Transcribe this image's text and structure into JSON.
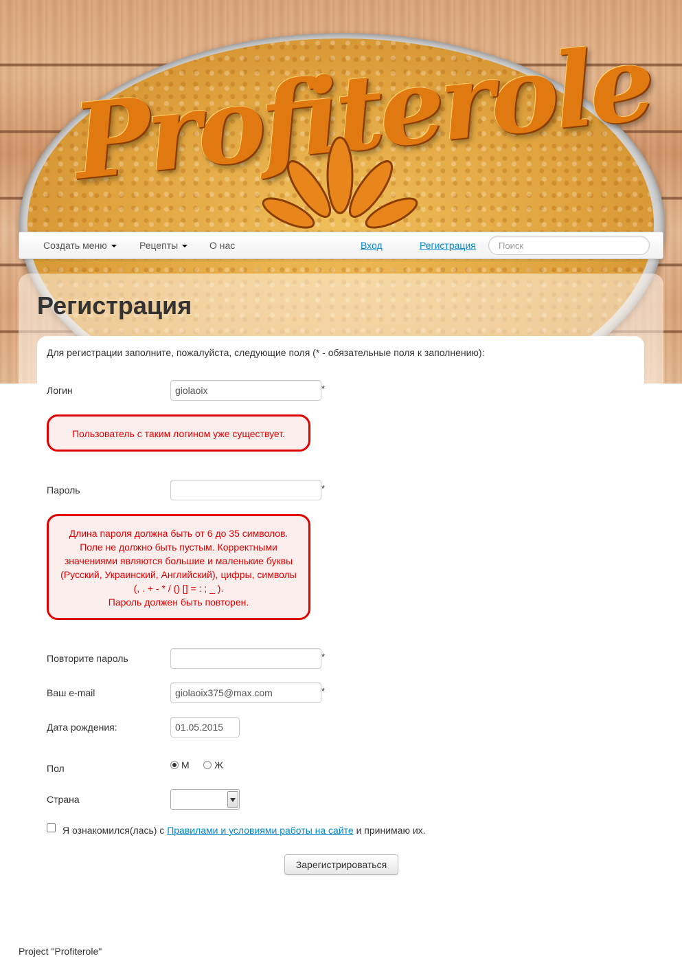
{
  "header": {
    "logo_text": "Profiterole"
  },
  "nav": {
    "menu_items": [
      {
        "label": "Создать меню",
        "has_dropdown": true
      },
      {
        "label": "Рецепты",
        "has_dropdown": true
      },
      {
        "label": "О нас",
        "has_dropdown": false
      }
    ],
    "login_link": "Вход",
    "register_link": "Регистрация",
    "search_placeholder": "Поиск"
  },
  "page": {
    "title": "Регистрация",
    "intro": "Для регистрации заполните, пожалуйста, следующие поля (* - обязательные поля к заполнению):"
  },
  "form": {
    "required_mark": "*",
    "login": {
      "label": "Логин",
      "value": "giolaoix"
    },
    "login_error": "Пользователь с таким логином уже существует.",
    "password": {
      "label": "Пароль",
      "value": ""
    },
    "password_error": [
      "Длина пароля должна быть от 6 до 35 символов.",
      "Поле не должно быть пустым. Корректными",
      "значениями являются большие и маленькие буквы",
      "(Русский, Украинский, Английский), цифры, символы",
      "(, . + - * / () [] = : ; _ ).",
      "Пароль должен быть повторен."
    ],
    "password_repeat": {
      "label": "Повторите пароль",
      "value": ""
    },
    "email": {
      "label": "Ваш e-mail",
      "value": "giolaoix375@max.com"
    },
    "birthdate": {
      "label": "Дата рождения:",
      "value": "01.05.2015"
    },
    "gender": {
      "label": "Пол",
      "options": [
        "М",
        "Ж"
      ],
      "selected": "М"
    },
    "country": {
      "label": "Страна",
      "value": ""
    },
    "agree": {
      "prefix": "Я ознакомился(лась) с ",
      "link": "Правилами и условиями работы на сайте",
      "suffix": " и принимаю их.",
      "checked": false
    },
    "submit_label": "Зарегистрироваться"
  },
  "footer": {
    "text": "Project \"Profiterole\""
  },
  "colors": {
    "link": "#0088cc",
    "error": "#e00000",
    "error_bg": "#fdeeee"
  }
}
